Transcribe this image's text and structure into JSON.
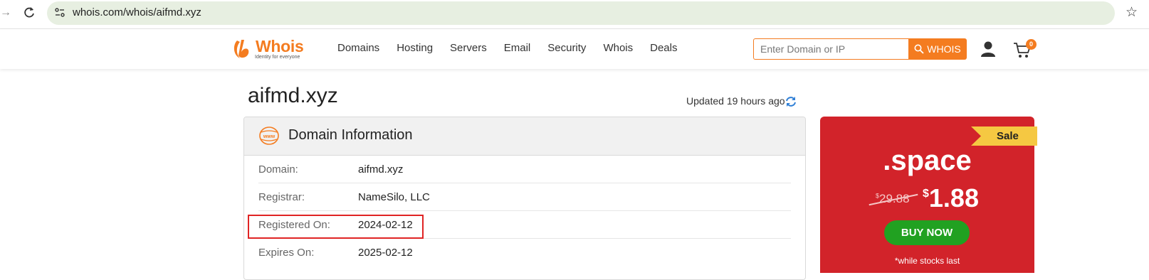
{
  "browser": {
    "url": "whois.com/whois/aifmd.xyz"
  },
  "header": {
    "logo_text": "Whois",
    "logo_tagline": "Identity for everyone",
    "nav": [
      "Domains",
      "Hosting",
      "Servers",
      "Email",
      "Security",
      "Whois",
      "Deals"
    ],
    "search_placeholder": "Enter Domain or IP",
    "search_button": "WHOIS",
    "cart_count": "0",
    "accent_color": "#f47c20"
  },
  "page": {
    "domain_title": "aifmd.xyz",
    "updated": "Updated 19 hours ago"
  },
  "domain_info": {
    "title": "Domain Information",
    "rows": [
      {
        "label": "Domain:",
        "value": "aifmd.xyz"
      },
      {
        "label": "Registrar:",
        "value": "NameSilo, LLC"
      },
      {
        "label": "Registered On:",
        "value": "2024-02-12"
      },
      {
        "label": "Expires On:",
        "value": "2025-02-12"
      }
    ]
  },
  "sale": {
    "ribbon": "Sale",
    "tld": ".space",
    "old_currency": "$",
    "old_price": "29.88",
    "new_currency": "$",
    "new_price": "1.88",
    "button": "BUY NOW",
    "note": "*while stocks last",
    "bg_color": "#d2232a",
    "button_color": "#21a121"
  }
}
